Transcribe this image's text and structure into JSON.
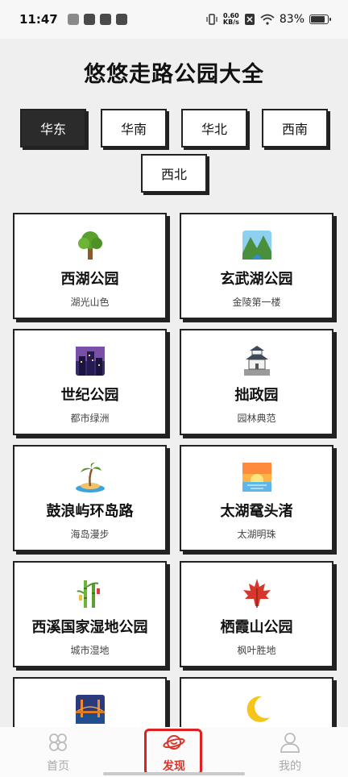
{
  "status_bar": {
    "time": "11:47",
    "net_speed_value": "0.60",
    "net_speed_unit": "KB/s",
    "battery": "83%"
  },
  "title": "悠悠走路公园大全",
  "regions": [
    {
      "label": "华东",
      "active": true
    },
    {
      "label": "华南",
      "active": false
    },
    {
      "label": "华北",
      "active": false
    },
    {
      "label": "西南",
      "active": false
    },
    {
      "label": "西北",
      "active": false
    }
  ],
  "parks": [
    {
      "name": "西湖公园",
      "subtitle": "湖光山色",
      "icon": "tree-icon"
    },
    {
      "name": "玄武湖公园",
      "subtitle": "金陵第一楼",
      "icon": "lake-mountain-icon"
    },
    {
      "name": "世纪公园",
      "subtitle": "都市绿洲",
      "icon": "city-night-icon"
    },
    {
      "name": "拙政园",
      "subtitle": "园林典范",
      "icon": "castle-icon"
    },
    {
      "name": "鼓浪屿环岛路",
      "subtitle": "海岛漫步",
      "icon": "island-icon"
    },
    {
      "name": "太湖鼋头渚",
      "subtitle": "太湖明珠",
      "icon": "sunrise-icon"
    },
    {
      "name": "西溪国家湿地公园",
      "subtitle": "城市湿地",
      "icon": "bamboo-icon"
    },
    {
      "name": "栖霞山公园",
      "subtitle": "枫叶胜地",
      "icon": "maple-leaf-icon"
    },
    {
      "name": "",
      "subtitle": "",
      "icon": "bridge-night-icon"
    },
    {
      "name": "",
      "subtitle": "",
      "icon": "moon-icon"
    }
  ],
  "nav": {
    "home": "首页",
    "discover": "发现",
    "mine": "我的"
  },
  "colors": {
    "active_tab": "#2b2b2b",
    "nav_active": "#d8362b",
    "highlight": "#e02020"
  }
}
